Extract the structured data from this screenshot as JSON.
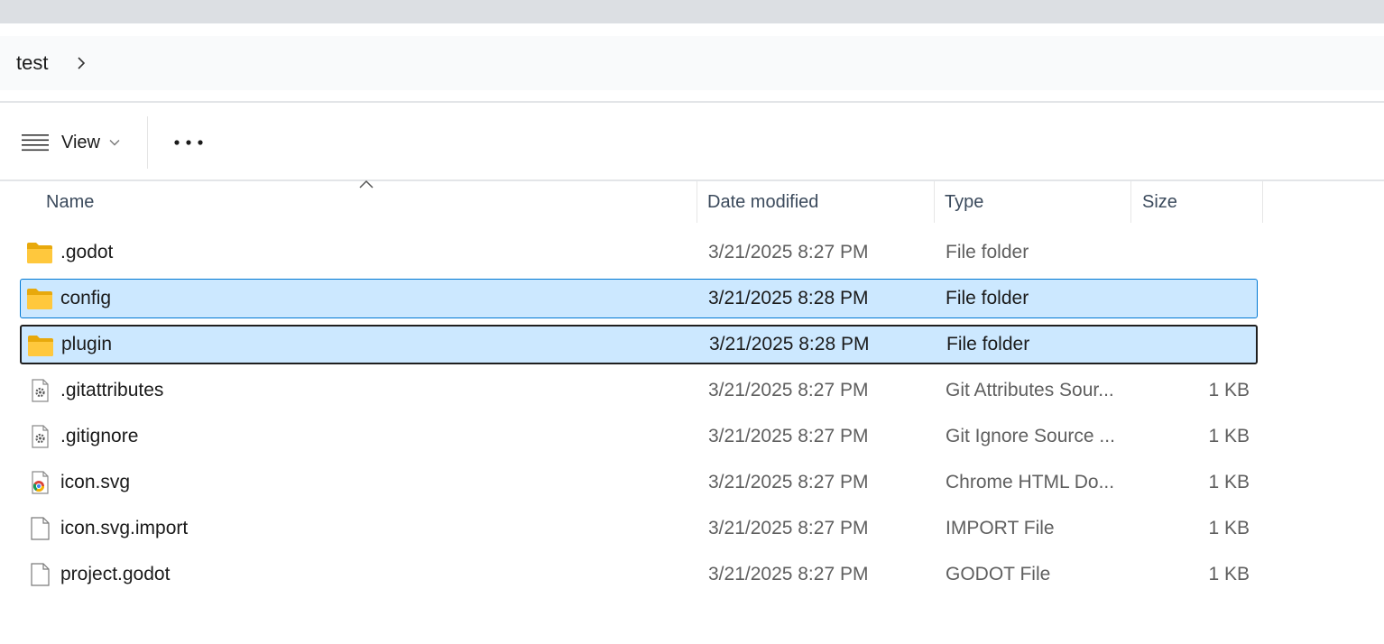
{
  "breadcrumb": {
    "items": [
      "test"
    ]
  },
  "toolbar": {
    "view_label": "View"
  },
  "columns": {
    "name": "Name",
    "date": "Date modified",
    "type": "Type",
    "size": "Size"
  },
  "files": [
    {
      "name": ".godot",
      "date": "3/21/2025 8:27 PM",
      "type": "File folder",
      "size": "",
      "icon": "folder-icon"
    },
    {
      "name": "config",
      "date": "3/21/2025 8:28 PM",
      "type": "File folder",
      "size": "",
      "icon": "folder-icon",
      "state": "selected"
    },
    {
      "name": "plugin",
      "date": "3/21/2025 8:28 PM",
      "type": "File folder",
      "size": "",
      "icon": "folder-icon",
      "state": "selected-focused"
    },
    {
      "name": ".gitattributes",
      "date": "3/21/2025 8:27 PM",
      "type": "Git Attributes Sour...",
      "size": "1 KB",
      "icon": "settings-file-icon"
    },
    {
      "name": ".gitignore",
      "date": "3/21/2025 8:27 PM",
      "type": "Git Ignore Source ...",
      "size": "1 KB",
      "icon": "settings-file-icon"
    },
    {
      "name": "icon.svg",
      "date": "3/21/2025 8:27 PM",
      "type": "Chrome HTML Do...",
      "size": "1 KB",
      "icon": "chrome-file-icon"
    },
    {
      "name": "icon.svg.import",
      "date": "3/21/2025 8:27 PM",
      "type": "IMPORT File",
      "size": "1 KB",
      "icon": "blank-file-icon"
    },
    {
      "name": "project.godot",
      "date": "3/21/2025 8:27 PM",
      "type": "GODOT File",
      "size": "1 KB",
      "icon": "blank-file-icon"
    }
  ],
  "colors": {
    "selection_fill": "#cce8ff",
    "selection_border": "#0078d4",
    "focus_border": "#1f1f1f",
    "folder_yellow": "#ffc83d"
  }
}
